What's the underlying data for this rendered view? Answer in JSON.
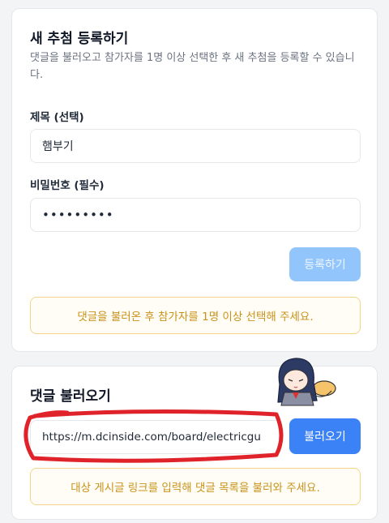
{
  "register": {
    "title": "새 추첨 등록하기",
    "description": "댓글을 불러오고 참가자를 1명 이상 선택한 후 새 추첨을 등록할 수 있습니다.",
    "title_label": "제목 (선택)",
    "title_value": "햄부기",
    "password_label": "비밀번호 (필수)",
    "password_value": "•••••••••",
    "submit_label": "등록하기",
    "notice": "댓글을 불러온 후 참가자를 1명 이상 선택해 주세요."
  },
  "load": {
    "title": "댓글 불러오기",
    "url_value": "https://m.dcinside.com/board/electricgu",
    "load_label": "불러오기",
    "notice": "대상 게시글 링크를 입력해 댓글 목록을 불러와 주세요."
  },
  "colors": {
    "accent": "#3b82f6",
    "accent_disabled": "#93c5fd",
    "notice_border": "#f3d48b",
    "notice_text": "#c9921b",
    "annotation": "#e0232a"
  },
  "decor": {
    "highlight_marker": "red hand-drawn circle around URL field",
    "sticker": "anime-girl-sticker"
  }
}
